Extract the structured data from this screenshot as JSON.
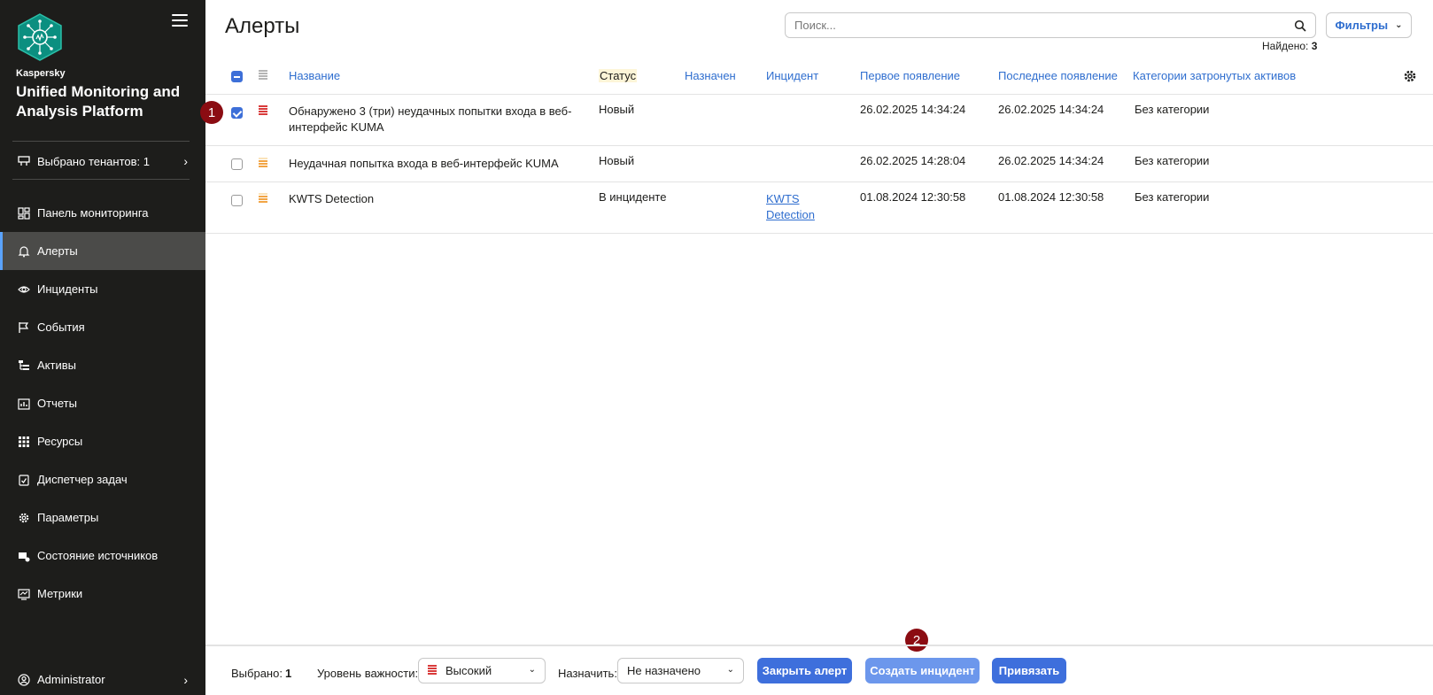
{
  "sidebar": {
    "brand_small": "Kaspersky",
    "brand_big": "Unified Monitoring and Analysis Platform",
    "tenants_label": "Выбрано тенантов: 1",
    "items": [
      {
        "label": "Панель мониторинга",
        "icon": "dashboard-icon"
      },
      {
        "label": "Алерты",
        "icon": "bell-icon"
      },
      {
        "label": "Инциденты",
        "icon": "eye-icon"
      },
      {
        "label": "События",
        "icon": "flag-icon"
      },
      {
        "label": "Активы",
        "icon": "hierarchy-icon"
      },
      {
        "label": "Отчеты",
        "icon": "report-icon"
      },
      {
        "label": "Ресурсы",
        "icon": "grid-icon"
      },
      {
        "label": "Диспетчер задач",
        "icon": "task-icon"
      },
      {
        "label": "Параметры",
        "icon": "gear-icon"
      },
      {
        "label": "Состояние источников",
        "icon": "source-icon"
      },
      {
        "label": "Метрики",
        "icon": "metrics-icon"
      }
    ],
    "active_item": "Алерты",
    "user": "Administrator"
  },
  "header": {
    "title": "Алерты",
    "search_placeholder": "Поиск...",
    "filters_label": "Фильтры",
    "found_label": "Найдено:",
    "found_count": "3"
  },
  "table": {
    "columns": {
      "name": "Название",
      "status": "Статус",
      "assigned": "Назначен",
      "incident": "Инцидент",
      "first_seen": "Первое появление",
      "last_seen": "Последнее появление",
      "categories": "Категории затронутых активов"
    },
    "rows": [
      {
        "checked": true,
        "severity": "high",
        "name": "Обнаружено 3 (три) неудачных попытки входа в веб-интерфейс KUMA",
        "status": "Новый",
        "assigned": "",
        "incident": "",
        "first_seen": "26.02.2025 14:34:24",
        "last_seen": "26.02.2025 14:34:24",
        "categories": "Без категории"
      },
      {
        "checked": false,
        "severity": "medium",
        "name": "Неудачная попытка входа в веб-интерфейс KUMA",
        "status": "Новый",
        "assigned": "",
        "incident": "",
        "first_seen": "26.02.2025 14:28:04",
        "last_seen": "26.02.2025 14:34:24",
        "categories": "Без категории"
      },
      {
        "checked": false,
        "severity": "medium",
        "name": "KWTS Detection",
        "status": "В инциденте",
        "assigned": "",
        "incident": "KWTS Detection",
        "first_seen": "01.08.2024 12:30:58",
        "last_seen": "01.08.2024 12:30:58",
        "categories": "Без категории"
      }
    ]
  },
  "markers": {
    "m1": "1",
    "m2": "2"
  },
  "bottom": {
    "selected_label": "Выбрано:",
    "selected_count": "1",
    "severity_label": "Уровень важности:",
    "severity_value": "Высокий",
    "assign_label": "Назначить:",
    "assign_value": "Не назначено",
    "close_btn": "Закрыть алерт",
    "create_btn": "Создать инцидент",
    "link_btn": "Привязать"
  },
  "colors": {
    "sidebar_bg": "#1d1d1b",
    "accent": "#3e6fdc",
    "link": "#2f6ecf",
    "severity_high": "#d93b3b",
    "severity_medium": "#f2a545",
    "marker": "#8b0c12"
  }
}
